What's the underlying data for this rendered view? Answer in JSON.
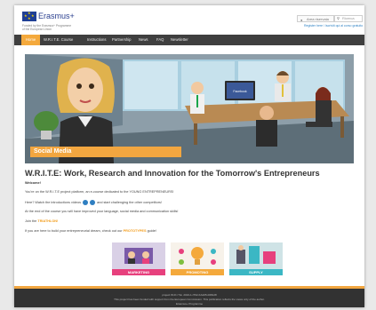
{
  "header": {
    "brand": "Erasmus+",
    "sub_line1": "Funded by the Erasmus+ Programme",
    "sub_line2": "of the European Union",
    "login_label": "Area riservata",
    "search_placeholder": "Ricerca",
    "register_text": "Register here / Iscriviti qui al corso gratuito"
  },
  "nav": {
    "items": [
      {
        "label": "Home"
      },
      {
        "label": "W.R.I.T.E. Course"
      },
      {
        "label": "Instructions"
      },
      {
        "label": "Partnership"
      },
      {
        "label": "News"
      },
      {
        "label": "FAQ"
      },
      {
        "label": "Newsletter"
      }
    ]
  },
  "hero": {
    "label": "Social Media",
    "laptop_text": "Facebook"
  },
  "content": {
    "title": "W.R.I.T.E: Work, Research and Innovation for the Tomorrow's Entrepreneurs",
    "welcome": "Welcome!",
    "p1": "You're on the W.R.I.T.E project platform, an e-course dedicated to the YOUNG ENTREPRENEURS!",
    "p2_before": "Here? Watch the introductions videos",
    "p2_after": "and start challenging the other competitors!",
    "p3": "At the end of the course you will have improved your language, social media and communication skills!",
    "p4_before": "Join the",
    "p4_link": "TRIATHLON!",
    "p5_before": "If you are here to build your entrepreneurial dream, check out our",
    "p5_link": "PROTOTYPES",
    "p5_after": "guide!"
  },
  "cards": [
    {
      "label": "MARKETING",
      "color": "#e7407d"
    },
    {
      "label": "PROMOTING",
      "color": "#f4a93c"
    },
    {
      "label": "SUPPLY",
      "color": "#3bb7c4"
    }
  ],
  "footer": {
    "line1": "project W.R.I.T.E.  2016-1-IT02-KA205-008128",
    "line2": "This project has been funded with support from the European Commission. This publication reflects the views only of the author.",
    "line3": "Erasmus+ Programme"
  },
  "colors": {
    "accent": "#f4a93c",
    "nav_bg": "#3f3f3f",
    "link": "#2f82c4",
    "footer_bg": "#323232"
  }
}
